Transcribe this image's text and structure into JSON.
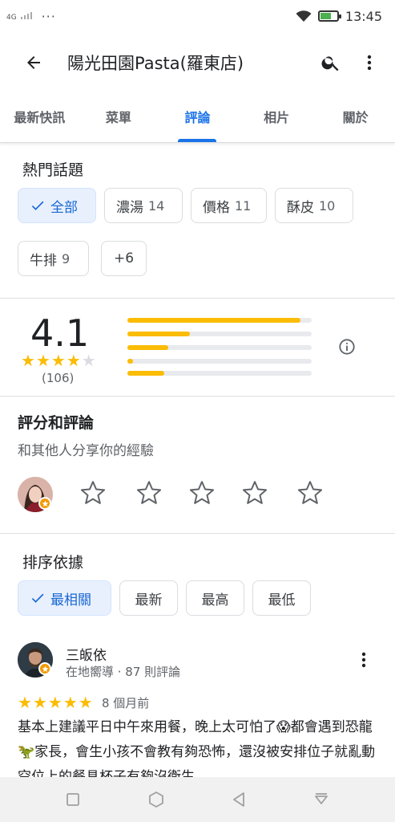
{
  "status_bar": {
    "network": "4G",
    "more": "···",
    "time": "13:45"
  },
  "app_bar": {
    "title": "陽光田園Pasta(羅東店)"
  },
  "tabs": [
    {
      "label": "最新快訊"
    },
    {
      "label": "菜單"
    },
    {
      "label": "評論"
    },
    {
      "label": "相片"
    },
    {
      "label": "關於"
    }
  ],
  "topics": {
    "title": "熱門話題",
    "chips": [
      {
        "label": "全部",
        "count": ""
      },
      {
        "label": "濃湯",
        "count": "14"
      },
      {
        "label": "價格",
        "count": "11"
      },
      {
        "label": "酥皮",
        "count": "10"
      },
      {
        "label": "牛排",
        "count": "9"
      },
      {
        "label": "+6",
        "count": ""
      }
    ]
  },
  "summary": {
    "rating": "4.1",
    "stars": 4,
    "count": "(106)",
    "distribution": [
      0.94,
      0.34,
      0.22,
      0.03,
      0.2
    ],
    "accent_color": "#fbbc04"
  },
  "rate_review": {
    "title": "評分和評論",
    "subtitle": "和其他人分享你的經驗"
  },
  "sort": {
    "title": "排序依據",
    "options": [
      {
        "label": "最相關"
      },
      {
        "label": "最新"
      },
      {
        "label": "最高"
      },
      {
        "label": "最低"
      }
    ]
  },
  "review": {
    "name": "三皈依",
    "meta": "在地嚮導 · 87 則評論",
    "stars": 5,
    "when": "8 個月前",
    "text": "基本上建議平日中午來用餐，晚上太可怕了😱都會遇到恐龍🦖家長，會生小孩不會教有夠恐怖，還沒被安排位子就亂動空位上的餐具杯子有夠沒衛生。"
  }
}
